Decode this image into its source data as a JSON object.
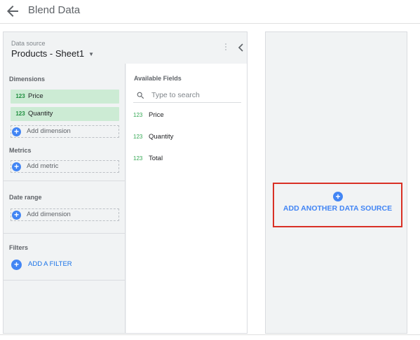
{
  "header": {
    "title": "Blend Data"
  },
  "data_source": {
    "label": "Data source",
    "name": "Products - Sheet1"
  },
  "dimensions": {
    "title": "Dimensions",
    "items": [
      {
        "type": "123",
        "label": "Price"
      },
      {
        "type": "123",
        "label": "Quantity"
      }
    ],
    "add_label": "Add dimension"
  },
  "metrics": {
    "title": "Metrics",
    "add_label": "Add metric"
  },
  "date_range": {
    "title": "Date range",
    "add_label": "Add dimension"
  },
  "filters": {
    "title": "Filters",
    "add_label": "ADD A FILTER"
  },
  "available_fields": {
    "title": "Available Fields",
    "search_placeholder": "Type to search",
    "items": [
      {
        "type": "123",
        "label": "Price"
      },
      {
        "type": "123",
        "label": "Quantity"
      },
      {
        "type": "123",
        "label": "Total"
      }
    ]
  },
  "add_source": {
    "label": "ADD ANOTHER DATA SOURCE"
  },
  "colors": {
    "accent": "#4285f4",
    "chip_bg": "#ccebd4",
    "highlight": "#d93025"
  },
  "icons": [
    "arrow-back-icon",
    "dropdown-caret-icon",
    "more-vert-icon",
    "chevron-left-icon",
    "search-icon",
    "plus-circle-icon"
  ]
}
